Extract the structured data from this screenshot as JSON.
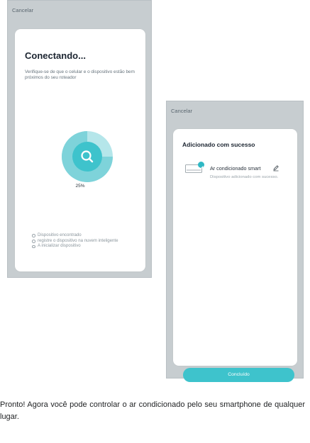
{
  "screen1": {
    "cancel": "Cancelar",
    "title": "Conectando...",
    "description": "Verifique-se de que o celular e o dispositivo estão bem próximos do seu roteador",
    "progress_percent": 25,
    "progress_label": "25%",
    "steps": [
      "Dispositivo encontrado",
      "registre o dispositivo na nuvem inteligente",
      "A inicializar dispositivo"
    ]
  },
  "screen2": {
    "cancel": "Cancelar",
    "title": "Adicionado com sucesso",
    "device_name": "Ar condicionado smart",
    "device_status": "Dispositivo adicionado com sucesso.",
    "button": "Concluído"
  },
  "caption": "Pronto! Agora você pode controlar o ar condicionado pelo seu smartphone de qualquer lugar.",
  "colors": {
    "accent": "#3ec3cc",
    "ring_light": "#b5e6ea",
    "ring_mid": "#7ed3da",
    "phone_bg": "#c7cdd0"
  },
  "icons": {
    "search": "search-icon",
    "check": "check-icon",
    "edit": "pencil-icon",
    "device": "air-conditioner-icon"
  }
}
